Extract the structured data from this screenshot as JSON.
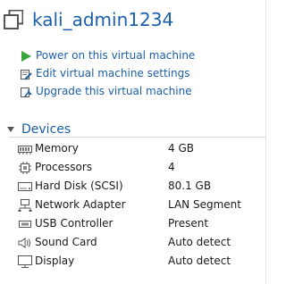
{
  "vm": {
    "name": "kali_admin1234"
  },
  "actions": [
    {
      "label": "Power on this virtual machine",
      "icon": "play-icon"
    },
    {
      "label": "Edit virtual machine settings",
      "icon": "edit-settings-icon"
    },
    {
      "label": "Upgrade this virtual machine",
      "icon": "upgrade-icon"
    }
  ],
  "devices": {
    "title": "Devices",
    "items": [
      {
        "name": "Memory",
        "value": "4 GB",
        "icon": "memory-icon"
      },
      {
        "name": "Processors",
        "value": "4",
        "icon": "processor-icon"
      },
      {
        "name": "Hard Disk (SCSI)",
        "value": "80.1 GB",
        "icon": "hard-disk-icon"
      },
      {
        "name": "Network Adapter",
        "value": "LAN Segment",
        "icon": "network-adapter-icon"
      },
      {
        "name": "USB Controller",
        "value": "Present",
        "icon": "usb-controller-icon"
      },
      {
        "name": "Sound Card",
        "value": "Auto detect",
        "icon": "sound-card-icon"
      },
      {
        "name": "Display",
        "value": "Auto detect",
        "icon": "display-icon"
      }
    ]
  },
  "colors": {
    "link": "#1d5fa8",
    "play": "#3aa53a"
  }
}
